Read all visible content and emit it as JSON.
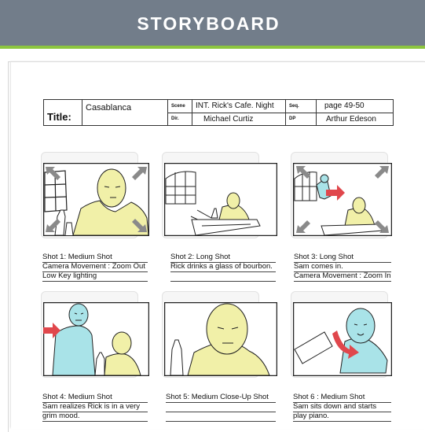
{
  "header": {
    "title": "STORYBOARD",
    "accent_color": "#8cc53f",
    "bg_color": "#727d8a"
  },
  "title_block": {
    "title_label": "Title:",
    "title_value": "Casablanca",
    "scene_label": "Scene",
    "scene_value": "INT. Rick's Cafe. Night",
    "dir_label": "Dir.",
    "dir_value": "Michael Curtiz",
    "seq_label": "Seq.",
    "seq_value": "page 49-50",
    "dp_label": "DP",
    "dp_value": "Arthur Edeson"
  },
  "shots": [
    {
      "lines": [
        "Shot 1: Medium Shot",
        "Camera Movement : Zoom Out",
        "Low Key lighting"
      ]
    },
    {
      "lines": [
        "Shot 2: Long Shot",
        "Rick drinks a glass of bourbon."
      ]
    },
    {
      "lines": [
        "Shot 3: Long Shot",
        "Sam comes in.",
        "Camera Movement : Zoom In"
      ]
    },
    {
      "lines": [
        "Shot 4: Medium Shot",
        "Sam realizes Rick is in a very",
        "grim mood."
      ]
    },
    {
      "lines": [
        "Shot 5: Medium Close-Up Shot"
      ]
    },
    {
      "lines": [
        "Shot 6  : Medium Shot",
        "Sam sits down and starts",
        "play piano."
      ]
    }
  ],
  "colors": {
    "rick": "#f1f0a8",
    "sam": "#a9e3e8",
    "arrow_gray": "#8a8a8a",
    "arrow_red": "#e0474c"
  }
}
